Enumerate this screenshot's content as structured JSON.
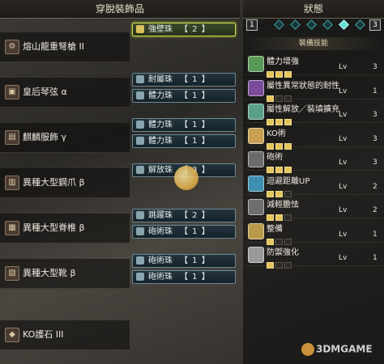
{
  "left_panel": {
    "title": "穿脫裝飾品",
    "equipment": [
      {
        "name": "熔山龍重弩槍 II",
        "icon": "heavy-bowgun-icon",
        "slots": [
          {
            "name": "強壁珠",
            "level": "【 2 】",
            "selected": true
          }
        ]
      },
      {
        "name": "皇后琴弦 α",
        "icon": "chest-armor-icon",
        "slots": [
          {
            "name": "耐屬珠",
            "level": "【 1 】"
          },
          {
            "name": "體力珠",
            "level": "【 1 】"
          }
        ]
      },
      {
        "name": "麒麟服飾 γ",
        "icon": "arm-armor-icon",
        "slots": [
          {
            "name": "體力珠",
            "level": "【 1 】"
          },
          {
            "name": "體力珠",
            "level": "【 1 】"
          }
        ]
      },
      {
        "name": "異種大型鋼爪 β",
        "icon": "gauntlet-icon",
        "slots": [
          {
            "name": "解放珠",
            "level": "【 3 】"
          }
        ]
      },
      {
        "name": "異種大型脊椎 β",
        "icon": "waist-armor-icon",
        "slots": [
          {
            "name": "跳躍珠",
            "level": "【 2 】"
          },
          {
            "name": "砲術珠",
            "level": "【 1 】"
          }
        ]
      },
      {
        "name": "異種大型靴 β",
        "icon": "boots-icon",
        "slots": [
          {
            "name": "砲術珠",
            "level": "【 1 】"
          },
          {
            "name": "砲術珠",
            "level": "【 1 】"
          }
        ]
      },
      {
        "name": "KO護石 III",
        "icon": "charm-icon",
        "slots": []
      }
    ]
  },
  "right_panel": {
    "title": "狀態",
    "tab_left": "1",
    "tab_right": "3",
    "subtitle": "裝備技能",
    "skills": [
      {
        "name": "體力增強",
        "lv_label": "Lv",
        "level": "3",
        "filled": 3,
        "total": 3,
        "color": "#5a9a58"
      },
      {
        "name": "屬性異常狀態的耐性",
        "lv_label": "Lv",
        "level": "1",
        "filled": 1,
        "total": 3,
        "color": "#7a4c9a"
      },
      {
        "name": "屬性解放／裝填擴充",
        "lv_label": "Lv",
        "level": "3",
        "filled": 3,
        "total": 3,
        "color": "#5aa08a"
      },
      {
        "name": "KO術",
        "lv_label": "Lv",
        "level": "3",
        "filled": 3,
        "total": 3,
        "color": "#c9a052"
      },
      {
        "name": "砲術",
        "lv_label": "Lv",
        "level": "3",
        "filled": 3,
        "total": 3,
        "color": "#6c6c6c"
      },
      {
        "name": "迴避距離UP",
        "lv_label": "Lv",
        "level": "2",
        "filled": 2,
        "total": 3,
        "color": "#3d8fb0"
      },
      {
        "name": "減輕膽怯",
        "lv_label": "Lv",
        "level": "2",
        "filled": 2,
        "total": 3,
        "color": "#6f6f6f"
      },
      {
        "name": "整備",
        "lv_label": "Lv",
        "level": "1",
        "filled": 1,
        "total": 3,
        "color": "#b99a4a"
      },
      {
        "name": "防禦強化",
        "lv_label": "Lv",
        "level": "1",
        "filled": 1,
        "total": 3,
        "color": "#9a9a9a"
      }
    ]
  },
  "watermark": "3DMGAME"
}
